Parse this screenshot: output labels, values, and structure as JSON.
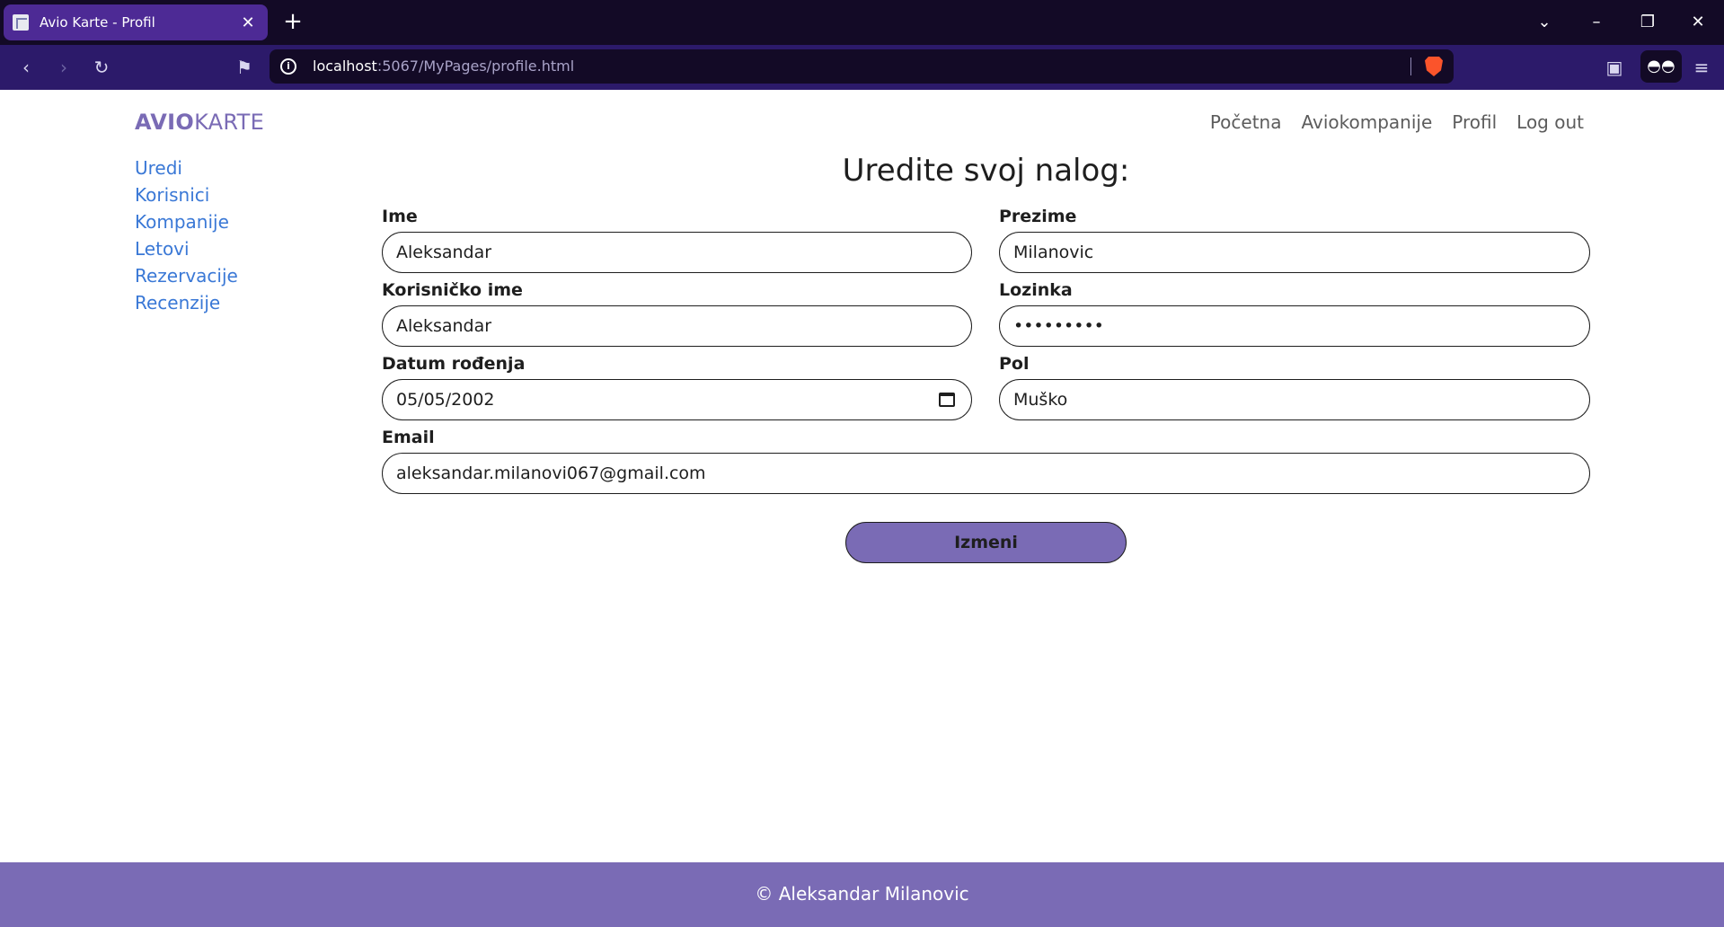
{
  "browser": {
    "tab_title": "Avio Karte - Profil",
    "url_host": "localhost",
    "url_rest": ":5067/MyPages/profile.html"
  },
  "brand": {
    "bold": "AVIO",
    "light": "KARTE"
  },
  "topnav": [
    "Početna",
    "Aviokompanije",
    "Profil",
    "Log out"
  ],
  "sidebar": [
    "Uredi",
    "Korisnici",
    "Kompanije",
    "Letovi",
    "Rezervacije",
    "Recenzije"
  ],
  "form": {
    "heading": "Uredite svoj nalog:",
    "ime_label": "Ime",
    "ime_value": "Aleksandar",
    "prezime_label": "Prezime",
    "prezime_value": "Milanovic",
    "korisnicko_label": "Korisničko ime",
    "korisnicko_value": "Aleksandar",
    "lozinka_label": "Lozinka",
    "lozinka_value": "aleksndr1",
    "datum_label": "Datum rođenja",
    "datum_value": "05/05/2002",
    "pol_label": "Pol",
    "pol_value": "Muško",
    "email_label": "Email",
    "email_value": "aleksandar.milanovi067@gmail.com",
    "submit_label": "Izmeni"
  },
  "footer": "© Aleksandar Milanovic",
  "colors": {
    "accent": "#7a6bb5",
    "link": "#3a78d6",
    "chrome_dark": "#130a26",
    "chrome_nav": "#2c1a6a",
    "tab_active": "#4d2a95"
  }
}
